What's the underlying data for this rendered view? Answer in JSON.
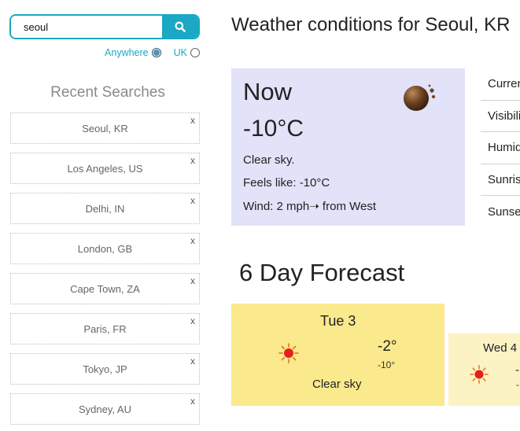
{
  "search": {
    "value": "seoul",
    "button_icon": "search-icon"
  },
  "region": {
    "options": [
      {
        "label": "Anywhere",
        "checked": true
      },
      {
        "label": "UK",
        "checked": false
      }
    ]
  },
  "recent": {
    "title": "Recent Searches",
    "remove_label": "x",
    "items": [
      "Seoul, KR",
      "Los Angeles, US",
      "Delhi, IN",
      "London, GB",
      "Cape Town, ZA",
      "Paris, FR",
      "Tokyo, JP",
      "Sydney, AU"
    ]
  },
  "heading": "Weather conditions for Seoul, KR",
  "now": {
    "label": "Now",
    "temp": "-10°C",
    "description": "Clear sky.",
    "feels_like": "Feels like: -10°C",
    "wind": "Wind: 2 mph➝ from West",
    "icon": "moon-icon"
  },
  "details": [
    "Current",
    "Visibility",
    "Humidity",
    "Sunrise",
    "Sunset"
  ],
  "forecast": {
    "title": "6 Day Forecast",
    "days": [
      {
        "name": "Tue 3",
        "high": "-2°",
        "low": "-10°",
        "desc": "Clear sky",
        "icon": "sun-icon"
      },
      {
        "name": "Wed 4",
        "high": "-",
        "low": "-",
        "desc": "",
        "icon": "sun-icon"
      }
    ]
  },
  "colors": {
    "accent": "#1aa8c4",
    "now_card": "#e2e2f8",
    "forecast_card": "#fbe98d",
    "forecast_card_light": "#fcf3c4"
  }
}
